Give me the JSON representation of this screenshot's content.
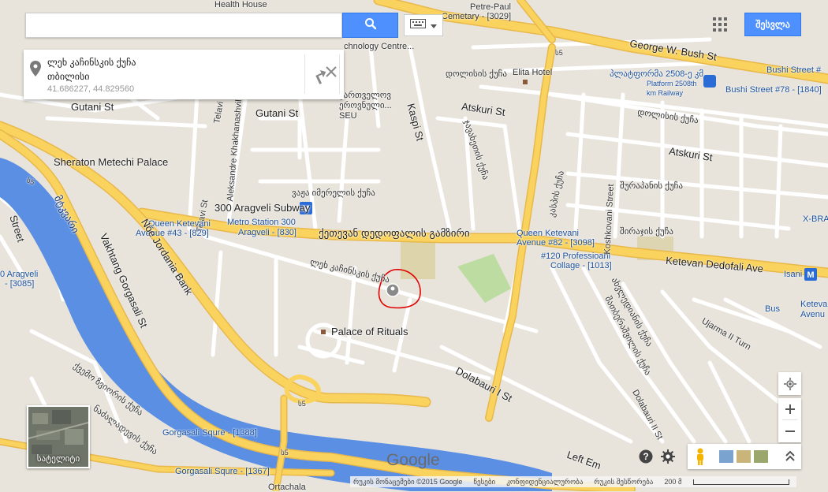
{
  "search": {
    "placeholder": "",
    "value": ""
  },
  "share_label": "შესვლა",
  "place_card": {
    "name": "ლეხ კაჩინსკის ქუჩა",
    "city": "თბილისი",
    "coords": "41.686227, 44.829560"
  },
  "map_labels": {
    "health_house": "Health House",
    "technology_centre": "chnology Centre...",
    "cemetery": "Cemetary - [3029]",
    "petre_paul": "Petre-Paul",
    "elita_hotel": "Elita Hotel",
    "george_bush": "George W. Bush St",
    "bushi_77": "Bushi Street #",
    "bushi_78": "Bushi Street #78 - [1840]",
    "platform_geo": "პლატფორმა 2508-ე კმ",
    "platform_en": "Platform 2508th km Railway",
    "dolisi_1": "დოლისის ქუჩა",
    "dolisi_2": "დოლისის ქუჩა",
    "atskuri_1": "Atskuri St",
    "atskuri_2": "Atskuri St",
    "gutani_1": "Gutani St",
    "gutani_2": "Gutani St",
    "telavi_1": "Telavi St",
    "telavi_2": "Telavi St",
    "aleksandre": "Aleksandre Khakhanashvili",
    "kaspi": "Kaspi St",
    "sheraton": "Sheraton Metechi Palace",
    "eroveuli": "ეროვნული...",
    "seu": "SEU",
    "kartvel": "ქართველოვ",
    "vazha": "ვაჟა იმერელის ქუჩა",
    "aragveli_sub": "300 Aragveli Subway",
    "metro_300_a": "Metro Station 300",
    "metro_300_b": "Aragveli - [830]",
    "queen_43_a": "Queen Ketevani",
    "queen_43_b": "Avenue #43 - [829]",
    "ketevan_geo": "ქეთევან დედოფალის გამზირი",
    "queen_82_a": "Queen Ketevani",
    "queen_82_b": "Avenue #82 - [3098]",
    "prof_a": "#120 Professioanl",
    "prof_b": "Collage - [1013]",
    "ketevan_en": "Ketevan Dedofali Ave",
    "isani": "Isani",
    "x_bra": "X-BRA",
    "bus_stop": "Bus",
    "keteva": "Keteva",
    "avenu": "Avenu",
    "lech_street": "ლეხ კაჩინსკის ქუჩა",
    "palace_rituals": "Palace of Rituals",
    "dolabauri_1": "Dolabauri I St",
    "dolabauri_2": "Dolabauri II St",
    "ujarma": "Ujarma II Turn",
    "koshkovani": "Koshkovani Street",
    "mtkvari": "მტკვარი",
    "aragveli_3085_a": "0 Aragveli",
    "aragveli_3085_b": "- [3085]",
    "vakhtang": "Vakhtang Gorgasali St",
    "noe": "Noe Jordania Bank",
    "gorgasali_1388": "Gorgasali Squre - [1388]",
    "gorgasali_1367": "Gorgasali Squre - [1367]",
    "left_em": "Left Em",
    "ortachala": "Ortachala",
    "street_left": "Street",
    "route_s5_a": "ს5",
    "route_s5_b": "ს5",
    "route_s5_c": "ს5",
    "route_s5_d": "ს5",
    "kaspi_geo": "კასპის ქუჩა",
    "javakheti": "ჯავახეთის ქუჩა",
    "sharpashi": "შირაჯის ქუჩა",
    "shrapanis": "შურაპანის ქუჩა",
    "akhvlediani": "ახვლედიანის ქუჩა",
    "shatberashvili": "შათბერაშვილის ქუჩა",
    "qvemo_street": "ქვემო ზვიორის ქუჩა",
    "nadzaladevi_street": "ნაძალადევის ქუჩა"
  },
  "satellite_label": "სატელიტი",
  "google_logo": "Google",
  "footer": {
    "map_data": "რუკის მონაცემები ©2015 Google",
    "terms": "წესები",
    "privacy": "კონფიდენციალურობა",
    "report": "რუკის შესწორება",
    "scale": "200 მ"
  },
  "colors": {
    "land": "#e8e4dc",
    "road_major": "#fad35e",
    "road_major_edge": "#e8b84a",
    "road_minor": "#ffffff",
    "water": "#5b8fe3",
    "park": "#bcdca1",
    "accent": "#4d90fe",
    "marker_circle": "#e00000"
  }
}
